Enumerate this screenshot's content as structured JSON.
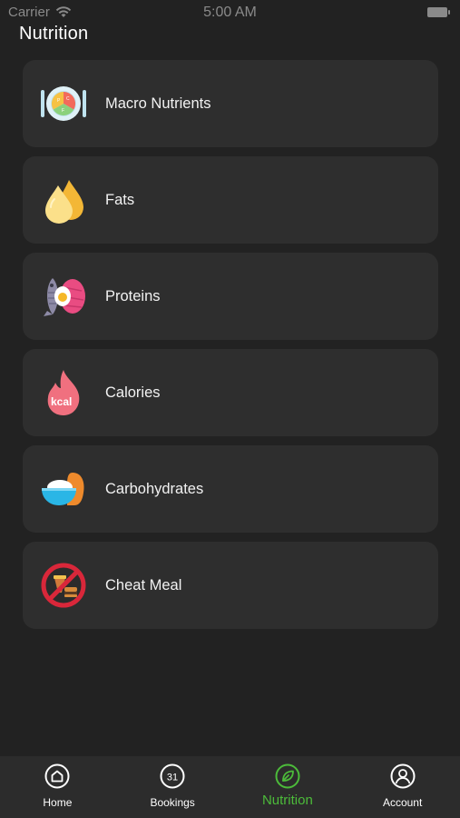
{
  "status_bar": {
    "carrier": "Carrier",
    "time": "5:00 AM"
  },
  "page": {
    "title": "Nutrition"
  },
  "items": [
    {
      "label": "Macro Nutrients",
      "icon": "macro-nutrients-plate-icon"
    },
    {
      "label": "Fats",
      "icon": "fat-drops-icon"
    },
    {
      "label": "Proteins",
      "icon": "proteins-fish-egg-icon"
    },
    {
      "label": "Calories",
      "icon": "kcal-flame-icon"
    },
    {
      "label": "Carbohydrates",
      "icon": "carbohydrates-bowl-icon"
    },
    {
      "label": "Cheat Meal",
      "icon": "no-cheat-meal-icon"
    }
  ],
  "tabbar": {
    "tabs": [
      {
        "label": "Home",
        "icon": "home-icon"
      },
      {
        "label": "Bookings",
        "icon": "calendar-31-icon",
        "badge": "31"
      },
      {
        "label": "Nutrition",
        "icon": "leaf-icon",
        "active": true
      },
      {
        "label": "Account",
        "icon": "user-circle-icon"
      }
    ]
  },
  "colors": {
    "background": "#222222",
    "card": "#2e2e2e",
    "accent": "#4cbb3a",
    "tabbar": "#2c2c2c"
  }
}
